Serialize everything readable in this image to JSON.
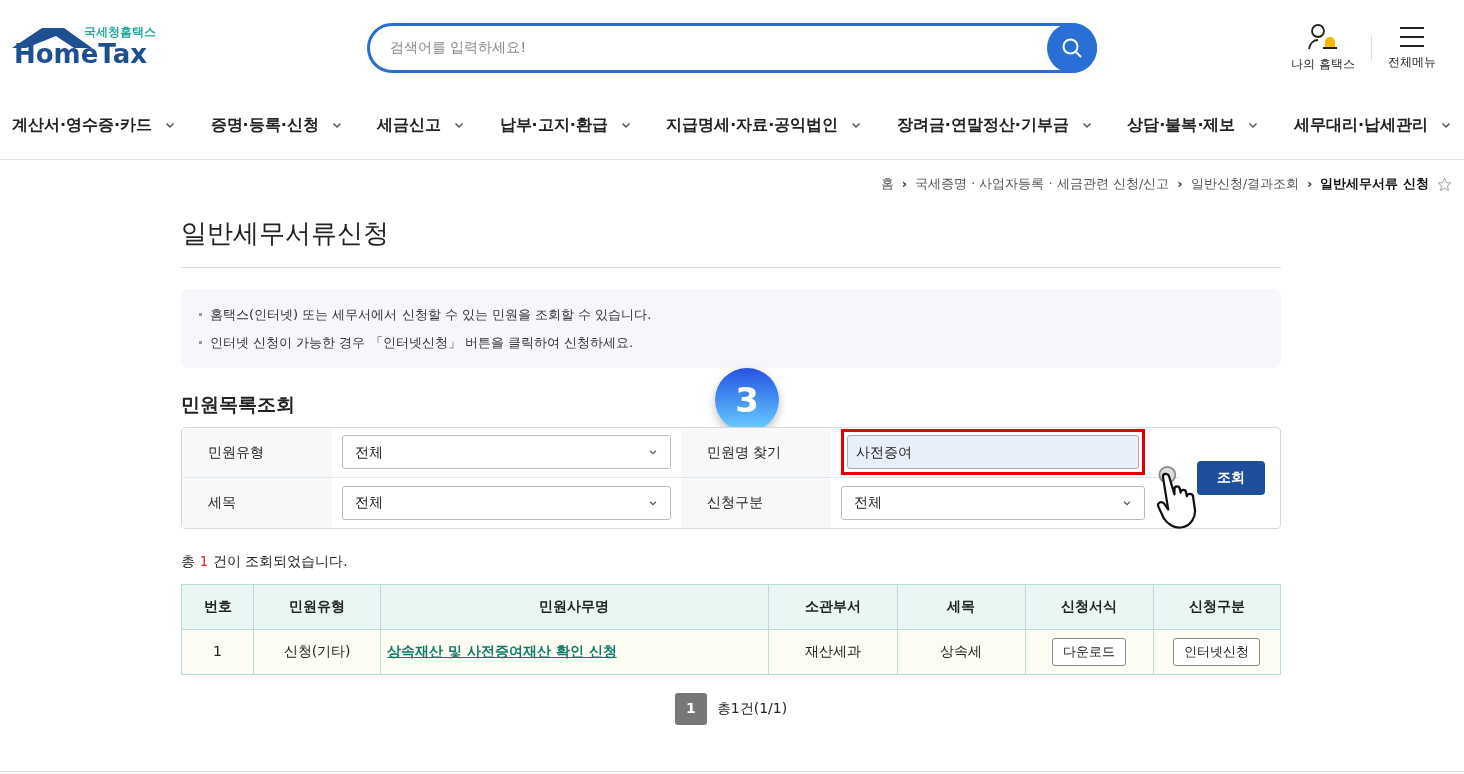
{
  "logo": {
    "subtitle": "국세청홈택스",
    "title": "HomeTax"
  },
  "search": {
    "placeholder": "검색어를 입력하세요!"
  },
  "header_links": [
    {
      "kind": "user",
      "label": "나의 홈택스"
    },
    {
      "kind": "menu",
      "label": "전체메뉴"
    }
  ],
  "nav": [
    "계산서·영수증·카드",
    "증명·등록·신청",
    "세금신고",
    "납부·고지·환급",
    "지급명세·자료·공익법인",
    "장려금·연말정산·기부금",
    "상담·불복·제보",
    "세무대리·납세관리"
  ],
  "breadcrumb": [
    {
      "label": "홈",
      "current": false
    },
    {
      "separator": "›",
      "label": "국세증명 · 사업자등록 · 세금관련 신청/신고",
      "current": false
    },
    {
      "separator": "›",
      "label": "일반신청/결과조회",
      "current": false
    },
    {
      "separator": "›",
      "label": "일반세무서류 신청",
      "current": true
    }
  ],
  "page_title": "일반세무서류신청",
  "notices": [
    "홈택스(인터넷) 또는 세무서에서 신청할 수 있는 민원을 조회할 수 있습니다.",
    "인터넷 신청이 가능한 경우 「인터넷신청」 버튼을 클릭하여 신청하세요."
  ],
  "step_badge": "3",
  "section_title": "민원목록조회",
  "filters": [
    {
      "label": "민원유형",
      "kind": "select",
      "value": "전체",
      "highlighted": false
    },
    {
      "label": "민원명 찾기",
      "kind": "text",
      "value": "사전증여",
      "highlighted": true
    },
    {
      "label": "세목",
      "kind": "select",
      "value": "전체",
      "highlighted": false
    },
    {
      "label": "신청구분",
      "kind": "select",
      "value": "전체",
      "highlighted": false
    }
  ],
  "search_button": "조회",
  "result_count": {
    "prefix": "총",
    "count": "1",
    "suffix": "건이 조회되었습니다."
  },
  "table": {
    "columns": [
      "번호",
      "민원유형",
      "민원사무명",
      "소관부서",
      "세목",
      "신청서식",
      "신청구분"
    ],
    "rows": [
      {
        "cells": [
          {
            "kind": "text",
            "text": "1"
          },
          {
            "kind": "text",
            "text": "신청(기타)"
          },
          {
            "kind": "link",
            "text": "상속재산 및 사전증여재산 확인 신청"
          },
          {
            "kind": "text",
            "text": "재산세과"
          },
          {
            "kind": "text",
            "text": "상속세"
          },
          {
            "kind": "button",
            "text": "다운로드"
          },
          {
            "kind": "button",
            "text": "인터넷신청"
          }
        ]
      }
    ]
  },
  "pagination": {
    "pages": [
      {
        "label": "1",
        "selected": true
      }
    ],
    "summary": "총1건(1/1)"
  }
}
